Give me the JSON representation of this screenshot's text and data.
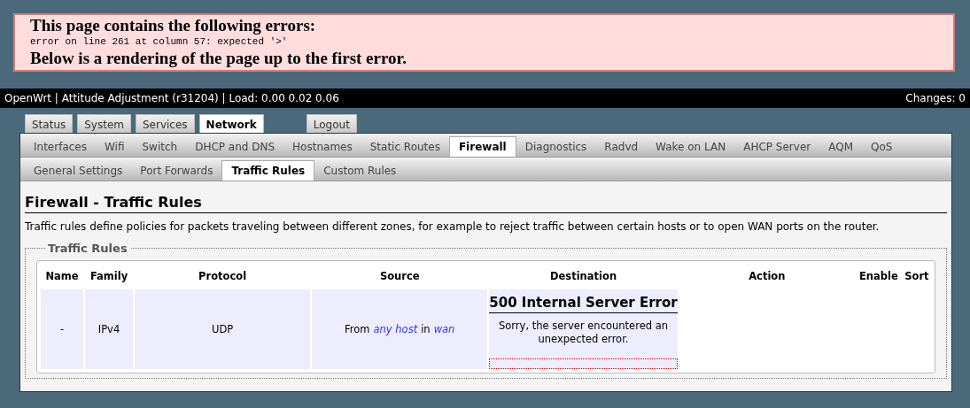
{
  "parse_error": {
    "title": "This page contains the following errors:",
    "detail": "error on line 261 at column 57: expected '>'",
    "footer": "Below is a rendering of the page up to the first error."
  },
  "header": {
    "title": "OpenWrt | Attitude Adjustment (r31204) | Load: 0.00 0.02 0.06",
    "changes": "Changes: 0"
  },
  "main_tabs": [
    {
      "label": "Status",
      "selected": false
    },
    {
      "label": "System",
      "selected": false
    },
    {
      "label": "Services",
      "selected": false
    },
    {
      "label": "Network",
      "selected": true
    },
    {
      "label": "Logout",
      "selected": false
    }
  ],
  "sub_tabs": [
    {
      "label": "Interfaces",
      "selected": false
    },
    {
      "label": "Wifi",
      "selected": false
    },
    {
      "label": "Switch",
      "selected": false
    },
    {
      "label": "DHCP and DNS",
      "selected": false
    },
    {
      "label": "Hostnames",
      "selected": false
    },
    {
      "label": "Static Routes",
      "selected": false
    },
    {
      "label": "Firewall",
      "selected": true
    },
    {
      "label": "Diagnostics",
      "selected": false
    },
    {
      "label": "Radvd",
      "selected": false
    },
    {
      "label": "Wake on LAN",
      "selected": false
    },
    {
      "label": "AHCP Server",
      "selected": false
    },
    {
      "label": "AQM",
      "selected": false
    },
    {
      "label": "QoS",
      "selected": false
    }
  ],
  "section_tabs": [
    {
      "label": "General Settings",
      "selected": false
    },
    {
      "label": "Port Forwards",
      "selected": false
    },
    {
      "label": "Traffic Rules",
      "selected": true
    },
    {
      "label": "Custom Rules",
      "selected": false
    }
  ],
  "page_title": "Firewall - Traffic Rules",
  "description": "Traffic rules define policies for packets traveling between different zones, for example to reject traffic between certain hosts or to open WAN ports on the router.",
  "fieldset": {
    "legend": "Traffic Rules",
    "columns": [
      "Name",
      "Family",
      "Protocol",
      "Source",
      "Destination",
      "Action",
      "Enable",
      "Sort"
    ],
    "rows": [
      {
        "name": "-",
        "family": "IPv4",
        "protocol": "UDP",
        "source": [
          {
            "kind": "plain",
            "text": "From"
          },
          {
            "kind": "link",
            "text": "any host"
          },
          {
            "kind": "plain",
            "text": "in"
          },
          {
            "kind": "link",
            "text": "wan"
          }
        ],
        "destination_error": {
          "title": "500 Internal Server Error",
          "message": "Sorry, the server encountered an unexpected error."
        }
      }
    ]
  }
}
